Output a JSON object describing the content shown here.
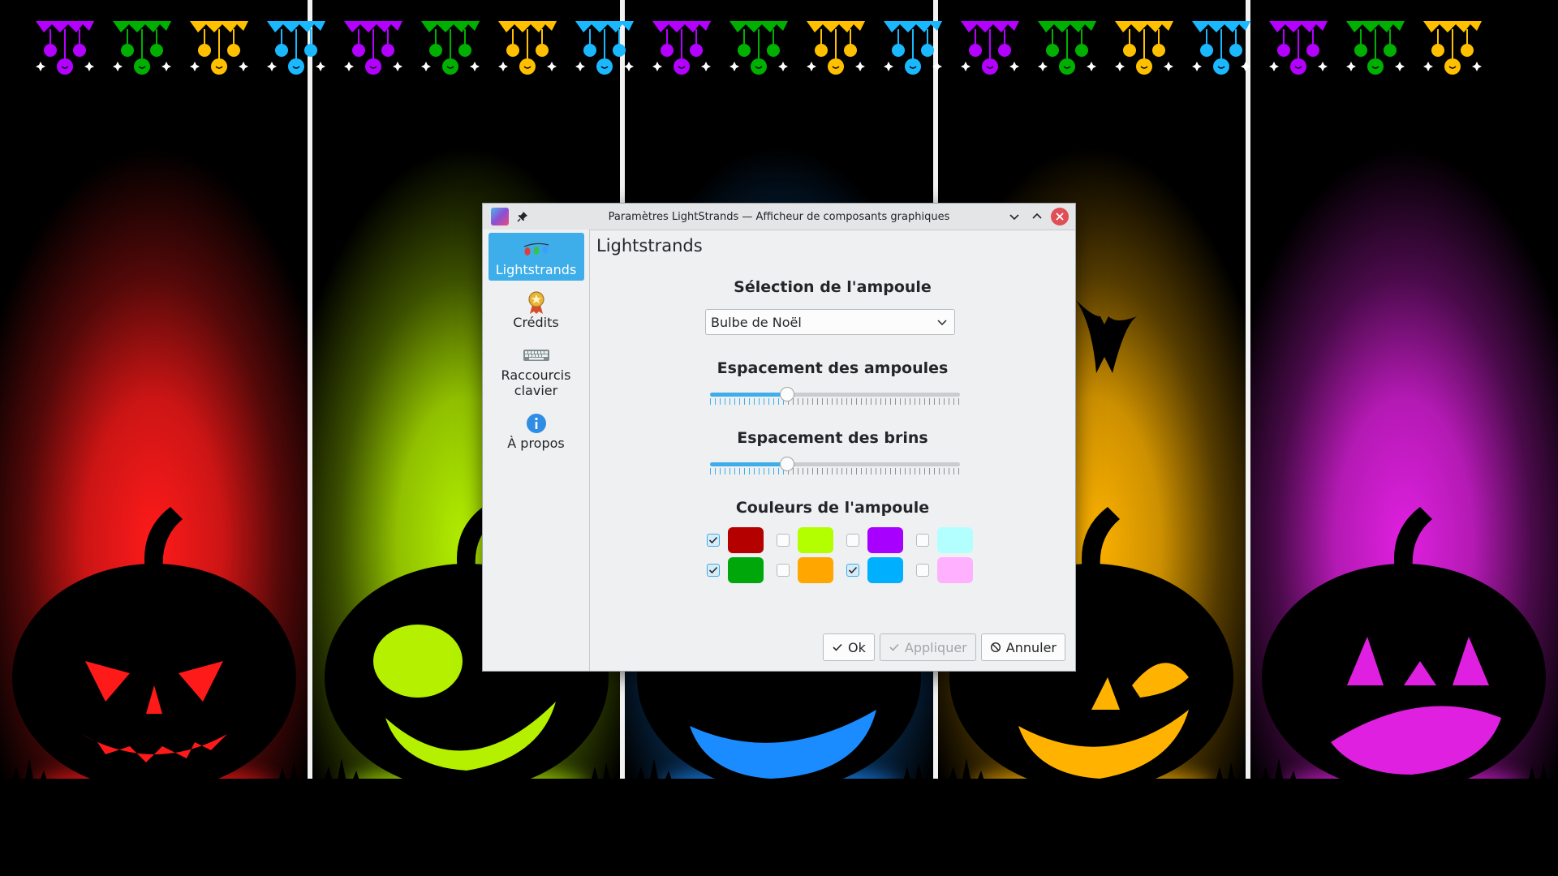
{
  "window": {
    "title": "Paramètres LightStrands — Afficheur de composants graphiques"
  },
  "sidebar": {
    "items": [
      {
        "label": "Lightstrands",
        "active": true
      },
      {
        "label": "Crédits",
        "active": false
      },
      {
        "label": "Raccourcis clavier",
        "active": false
      },
      {
        "label": "À propos",
        "active": false
      }
    ]
  },
  "page": {
    "title": "Lightstrands",
    "bulb_selection": {
      "label": "Sélection de l'ampoule",
      "value": "Bulbe de Noël"
    },
    "bulb_spacing": {
      "label": "Espacement des ampoules",
      "value_fraction": 0.31
    },
    "strand_spacing": {
      "label": "Espacement des brins",
      "value_fraction": 0.31
    },
    "bulb_colors": {
      "label": "Couleurs de l'ampoule",
      "rows": [
        [
          {
            "color": "#b50000",
            "checked": true
          },
          {
            "color": "#b3ff00",
            "checked": false
          },
          {
            "color": "#a700ff",
            "checked": false
          },
          {
            "color": "#b3ffff",
            "checked": false
          }
        ],
        [
          {
            "color": "#00a70b",
            "checked": true
          },
          {
            "color": "#ffa700",
            "checked": false
          },
          {
            "color": "#00b0ff",
            "checked": true
          },
          {
            "color": "#ffb0ff",
            "checked": false
          }
        ]
      ]
    }
  },
  "buttons": {
    "ok": "Ok",
    "apply": "Appliquer",
    "cancel": "Annuler"
  },
  "wallpaper": {
    "panel_colors": [
      "#ff1a1a",
      "#b4f000",
      "#1a8cff",
      "#ffb300",
      "#e020e0"
    ],
    "strand_colors": [
      "#b400ff",
      "#00b000",
      "#ffc000",
      "#1ab8ff"
    ]
  }
}
